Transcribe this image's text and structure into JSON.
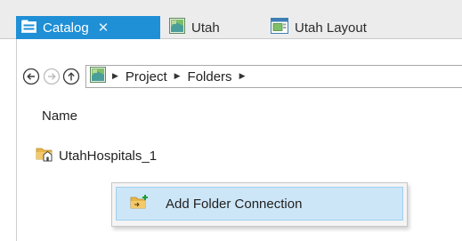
{
  "tabs": [
    {
      "label": "Catalog",
      "icon": "catalog-icon",
      "active": true,
      "closable": true,
      "close_glyph": "✕"
    },
    {
      "label": "Utah",
      "icon": "map-icon",
      "active": false
    },
    {
      "label": "Utah Layout",
      "icon": "layout-icon",
      "active": false
    }
  ],
  "nav": {
    "back_icon": "back-arrow-icon",
    "forward_icon": "forward-arrow-icon",
    "up_icon": "up-arrow-icon"
  },
  "breadcrumb": {
    "separator": "▶",
    "items": [
      "Project",
      "Folders"
    ]
  },
  "content": {
    "column_header": "Name",
    "items": [
      {
        "label": "UtahHospitals_1",
        "icon": "home-folder-icon"
      }
    ]
  },
  "context_menu": {
    "items": [
      {
        "label": "Add Folder Connection",
        "icon": "add-folder-connection-icon",
        "highlighted": true
      }
    ]
  },
  "colors": {
    "accent": "#1f8fd6",
    "menu_highlight": "#cde6f7",
    "menu_highlight_border": "#9fd0f0"
  }
}
